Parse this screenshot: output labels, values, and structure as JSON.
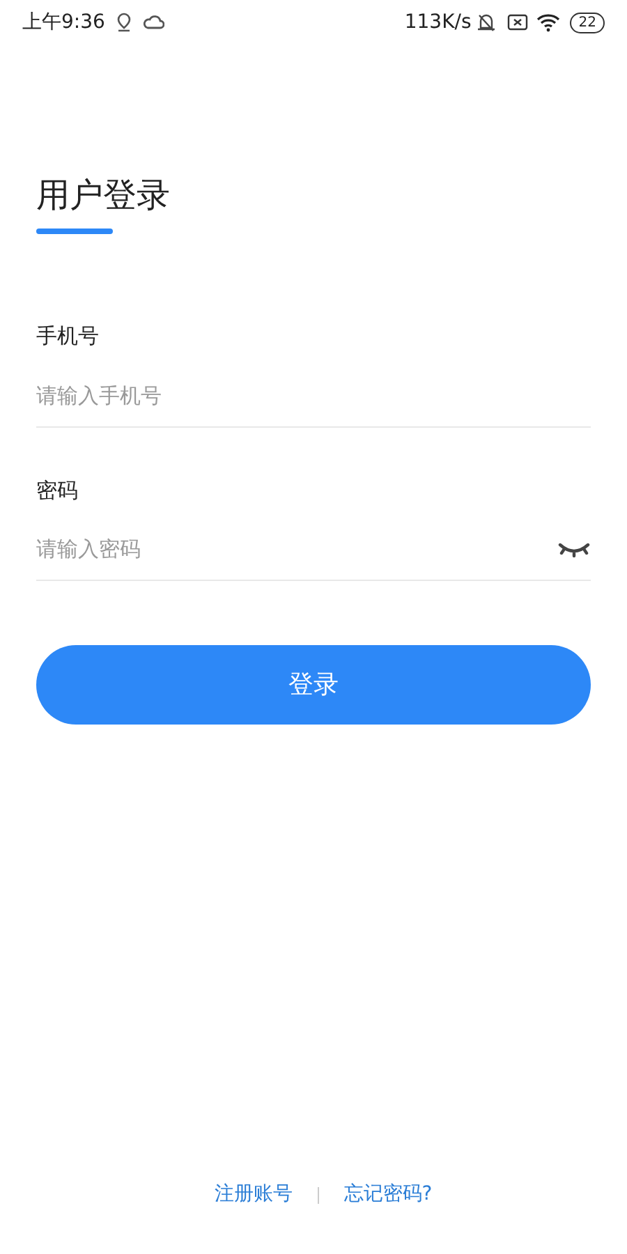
{
  "status_bar": {
    "time": "上午9:36",
    "net_speed": "113K/s",
    "battery": "22"
  },
  "title": "用户登录",
  "fields": [
    {
      "label": "手机号",
      "placeholder": "请输入手机号",
      "kind": "text"
    },
    {
      "label": "密码",
      "placeholder": "请输入密码",
      "kind": "password"
    }
  ],
  "login_button": "登录",
  "footer_links": [
    "注册账号",
    "忘记密码?"
  ]
}
